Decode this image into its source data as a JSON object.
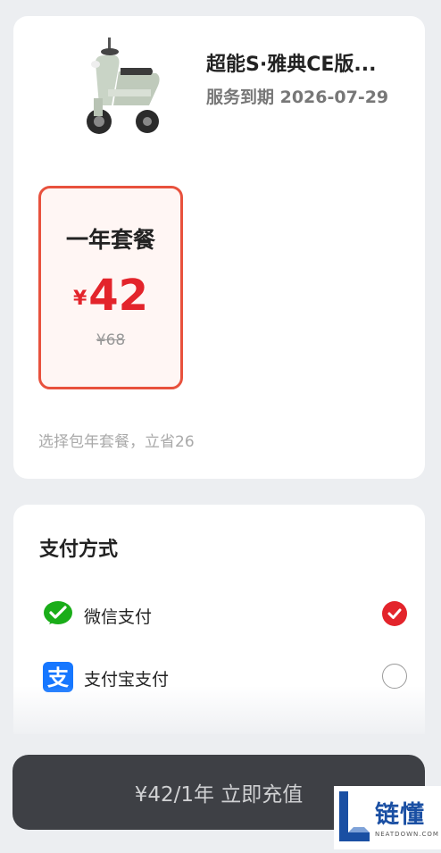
{
  "product": {
    "title": "超能S·雅典CE版...",
    "expire": "服务到期 2026-07-29",
    "image": "scooter-image"
  },
  "plan": {
    "name": "一年套餐",
    "currency": "¥",
    "price": "42",
    "original": "¥68",
    "tip": "选择包年套餐，立省26"
  },
  "payment": {
    "title": "支付方式",
    "methods": [
      {
        "label": "微信支付",
        "icon": "wechat-pay-icon",
        "selected": true
      },
      {
        "label": "支付宝支付",
        "icon": "alipay-icon",
        "selected": false
      }
    ]
  },
  "action": {
    "button": "¥42/1年 立即充值"
  },
  "watermark": {
    "name": "链懂",
    "sub": "NEATDOWN.COM"
  },
  "colors": {
    "accent": "#e3242b",
    "plan_border": "#e8513d",
    "wechat": "#1aad19",
    "alipay": "#1677ff"
  }
}
